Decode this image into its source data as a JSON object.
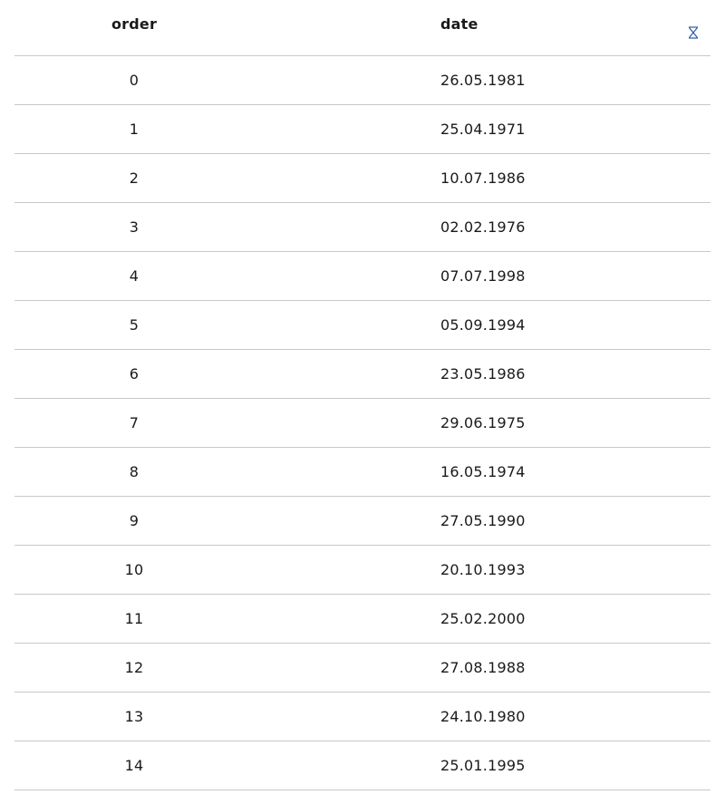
{
  "table": {
    "columns": {
      "order": "order",
      "date": "date"
    },
    "sort_icon": "sort-toggle-icon",
    "accent_color": "#2a5aa8",
    "rows": [
      {
        "order": "0",
        "date": "26.05.1981"
      },
      {
        "order": "1",
        "date": "25.04.1971"
      },
      {
        "order": "2",
        "date": "10.07.1986"
      },
      {
        "order": "3",
        "date": "02.02.1976"
      },
      {
        "order": "4",
        "date": "07.07.1998"
      },
      {
        "order": "5",
        "date": "05.09.1994"
      },
      {
        "order": "6",
        "date": "23.05.1986"
      },
      {
        "order": "7",
        "date": "29.06.1975"
      },
      {
        "order": "8",
        "date": "16.05.1974"
      },
      {
        "order": "9",
        "date": "27.05.1990"
      },
      {
        "order": "10",
        "date": "20.10.1993"
      },
      {
        "order": "11",
        "date": "25.02.2000"
      },
      {
        "order": "12",
        "date": "27.08.1988"
      },
      {
        "order": "13",
        "date": "24.10.1980"
      },
      {
        "order": "14",
        "date": "25.01.1995"
      }
    ]
  }
}
